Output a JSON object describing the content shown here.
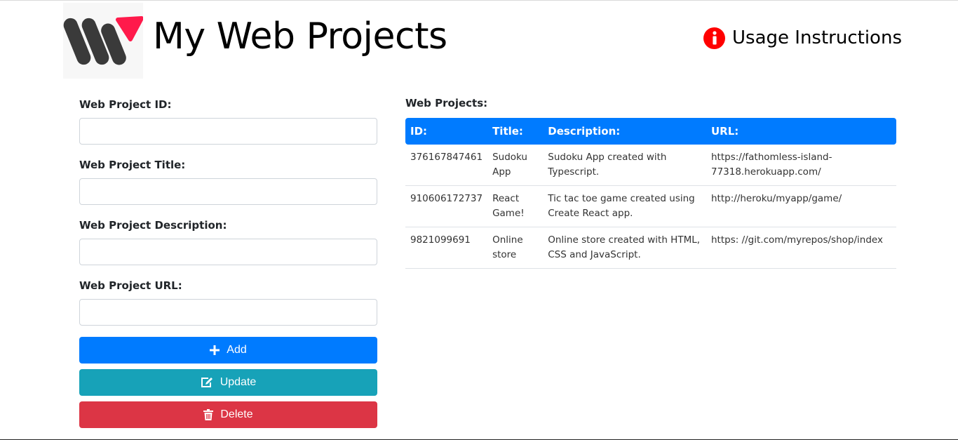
{
  "header": {
    "title": "My Web Projects",
    "usage_label": "Usage Instructions"
  },
  "form": {
    "id_label": "Web Project ID:",
    "id_value": "",
    "title_label": "Web Project Title:",
    "title_value": "",
    "description_label": "Web Project Description:",
    "description_value": "",
    "url_label": "Web Project URL:",
    "url_value": "",
    "add_label": "Add",
    "update_label": "Update",
    "delete_label": "Delete"
  },
  "projects": {
    "heading": "Web Projects:",
    "columns": [
      "ID:",
      "Title:",
      "Description:",
      "URL:"
    ],
    "rows": [
      {
        "id": "376167847461",
        "title": "Sudoku App",
        "description": "Sudoku App created with Typescript.",
        "url": "https://fathomless-island-77318.herokuapp.com/"
      },
      {
        "id": "910606172737",
        "title": "React Game!",
        "description": "Tic tac toe game created using Create React app.",
        "url": "http://heroku/myapp/game/"
      },
      {
        "id": "9821099691",
        "title": "Online store",
        "description": "Online store created with HTML, CSS and JavaScript.",
        "url": "https: //git.com/myrepos/shop/index"
      }
    ]
  },
  "icons": {
    "logo": "w-logo-icon",
    "info": "info-circle-icon",
    "add": "plus-icon",
    "update": "edit-icon",
    "delete": "trash-icon"
  },
  "colors": {
    "primary": "#007bff",
    "info_button": "#17a2b8",
    "danger": "#dc3545",
    "info_icon": "#ff0000",
    "logo_accent": "#ff1a4b",
    "logo_dark": "#3a3a3a"
  }
}
